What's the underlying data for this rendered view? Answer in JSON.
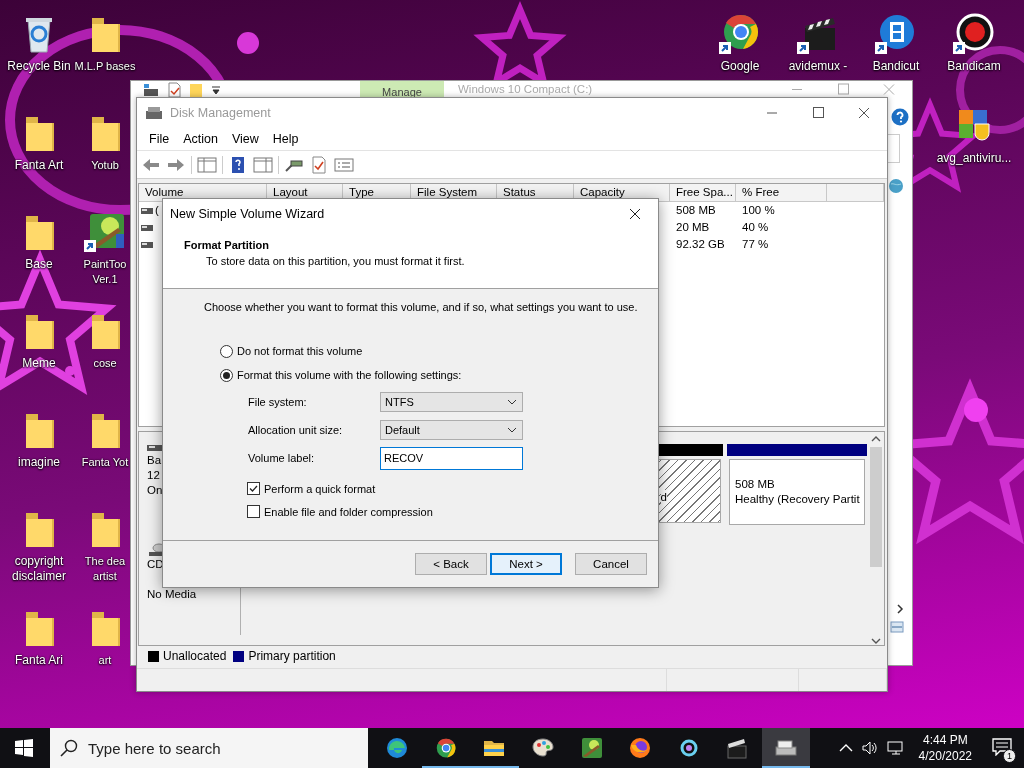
{
  "desktop": {
    "left_columns": [
      [
        {
          "lines": [
            "Recycle Bin"
          ],
          "kind": "recycle",
          "shortcut": false
        },
        {
          "lines": [
            "Fanta Art"
          ],
          "kind": "folder",
          "shortcut": false
        },
        {
          "lines": [
            "Base"
          ],
          "kind": "folder",
          "shortcut": false
        },
        {
          "lines": [
            "Meme"
          ],
          "kind": "folder",
          "shortcut": false
        },
        {
          "lines": [
            "imagine"
          ],
          "kind": "folder",
          "shortcut": false
        },
        {
          "lines": [
            "copyright",
            "disclaimer"
          ],
          "kind": "folder",
          "shortcut": false
        },
        {
          "lines": [
            "Fanta Ari"
          ],
          "kind": "folder",
          "shortcut": false
        }
      ],
      [
        {
          "lines": [
            "M.L.P bases"
          ],
          "kind": "folder",
          "shortcut": false
        },
        {
          "lines": [
            "Yotub"
          ],
          "kind": "folder",
          "shortcut": false
        },
        {
          "lines": [
            "PaintToo",
            "Ver.1"
          ],
          "kind": "app",
          "shortcut": true
        },
        {
          "lines": [
            "cose"
          ],
          "kind": "folder",
          "shortcut": false
        },
        {
          "lines": [
            "Fanta Yot"
          ],
          "kind": "folder",
          "shortcut": false
        },
        {
          "lines": [
            "The dea",
            "artist"
          ],
          "kind": "folder",
          "shortcut": false
        },
        {
          "lines": [
            "art"
          ],
          "kind": "folder",
          "shortcut": false
        }
      ]
    ],
    "top_right": [
      {
        "lines": [
          "Google"
        ],
        "kind": "chrome",
        "shortcut": true
      },
      {
        "lines": [
          "avidemux -"
        ],
        "kind": "clapper",
        "shortcut": true
      },
      {
        "lines": [
          "Bandicut"
        ],
        "kind": "bandicut",
        "shortcut": true
      },
      {
        "lines": [
          "Bandicam"
        ],
        "kind": "bandicam",
        "shortcut": true
      }
    ],
    "right": [
      {
        "lines": [
          "avg_antiviru..."
        ],
        "kind": "avg",
        "shortcut": false
      }
    ]
  },
  "explorer_window": {
    "title": "Windows 10 Compact (C:)",
    "ribbon_tab": "Manage"
  },
  "disk_management": {
    "title": "Disk Management",
    "menu": [
      "File",
      "Action",
      "View",
      "Help"
    ],
    "columns": [
      "Volume",
      "Layout",
      "Type",
      "File System",
      "Status",
      "Capacity",
      "Free Spa...",
      "% Free"
    ],
    "volumes": [
      {
        "volume": "(",
        "free_space": "508 MB",
        "percent_free": "100 %"
      },
      {
        "free_space": "20 MB",
        "percent_free": "40 %"
      },
      {
        "free_space": "92.32 GB",
        "percent_free": "77 %"
      }
    ],
    "disks": [
      {
        "kind": "disk",
        "label_lines": [
          "Ba",
          "12",
          "On"
        ],
        "partitions": [
          {
            "kind": "unallocated",
            "lines": [
              "d"
            ]
          },
          {
            "kind": "primary",
            "lines": [
              "508 MB",
              "Healthy (Recovery Partit"
            ]
          }
        ]
      },
      {
        "kind": "cdrom",
        "label_lines": [
          "CD",
          "No Media"
        ]
      }
    ],
    "legend": [
      {
        "label": "Unallocated",
        "color": "#000000"
      },
      {
        "label": "Primary partition",
        "color": "#000080"
      }
    ]
  },
  "wizard": {
    "title": "New Simple Volume Wizard",
    "heading": "Format Partition",
    "subheading": "To store data on this partition, you must format it first.",
    "instruction": "Choose whether you want to format this volume, and if so, what settings you want to use.",
    "options": [
      {
        "label": "Do not format this volume",
        "selected": false
      },
      {
        "label": "Format this volume with the following settings:",
        "selected": true
      }
    ],
    "fields": [
      {
        "label": "File system:",
        "kind": "select",
        "value": "NTFS"
      },
      {
        "label": "Allocation unit size:",
        "kind": "select",
        "value": "Default"
      },
      {
        "label": "Volume label:",
        "kind": "text",
        "value": "RECOV"
      }
    ],
    "checkboxes": [
      {
        "label": "Perform a quick format",
        "checked": true
      },
      {
        "label": "Enable file and folder compression",
        "checked": false
      }
    ],
    "buttons": [
      {
        "label": "< Back",
        "default": false
      },
      {
        "label": "Next >",
        "default": true
      },
      {
        "label": "Cancel",
        "default": false
      }
    ]
  },
  "taskbar": {
    "search": {
      "placeholder": "Type here to search"
    },
    "apps": [
      {
        "kind": "edge",
        "running": false,
        "active": false
      },
      {
        "kind": "chrome",
        "running": true,
        "active": false
      },
      {
        "kind": "explorer",
        "running": true,
        "active": false
      },
      {
        "kind": "paint",
        "running": false,
        "active": false
      },
      {
        "kind": "app",
        "running": false,
        "active": false
      },
      {
        "kind": "firefox",
        "running": false,
        "active": false
      },
      {
        "kind": "lens",
        "running": false,
        "active": false
      },
      {
        "kind": "clapper",
        "running": false,
        "active": false
      },
      {
        "kind": "disk",
        "running": true,
        "active": true
      }
    ],
    "time": "4:44 PM",
    "date": "4/20/2022",
    "notification_count": "1"
  }
}
